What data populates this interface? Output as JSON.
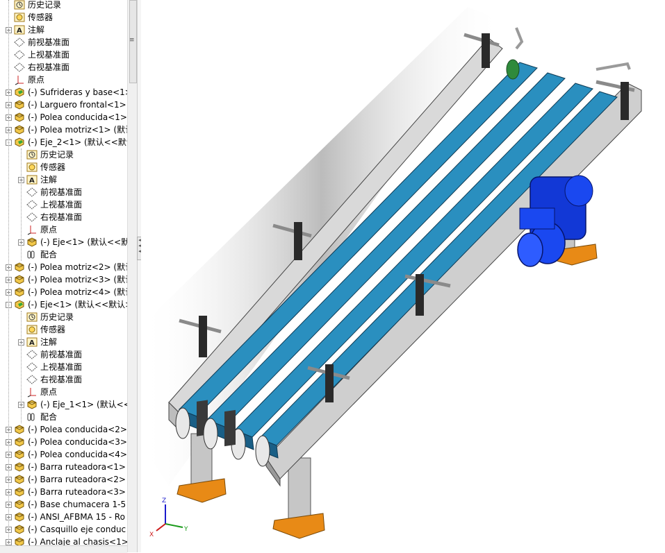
{
  "feature_tree": {
    "rows": [
      {
        "label": "历史记录",
        "icon": "history-icon",
        "indent": 1,
        "expand": ""
      },
      {
        "label": "传感器",
        "icon": "sensor-icon",
        "indent": 1,
        "expand": ""
      },
      {
        "label": "注解",
        "icon": "annotation-icon",
        "indent": 1,
        "expand": "+"
      },
      {
        "label": "前视基准面",
        "icon": "plane-icon",
        "indent": 1,
        "expand": ""
      },
      {
        "label": "上视基准面",
        "icon": "plane-icon",
        "indent": 1,
        "expand": ""
      },
      {
        "label": "右视基准面",
        "icon": "plane-icon",
        "indent": 1,
        "expand": ""
      },
      {
        "label": "原点",
        "icon": "origin-icon",
        "indent": 1,
        "expand": ""
      },
      {
        "label": "(-) Sufrideras y base<1>",
        "icon": "subassembly-icon",
        "indent": 1,
        "expand": "+"
      },
      {
        "label": "(-) Larguero frontal<1>",
        "icon": "part-icon",
        "indent": 1,
        "expand": "+"
      },
      {
        "label": "(-) Polea conducida<1>",
        "icon": "part-icon",
        "indent": 1,
        "expand": "+"
      },
      {
        "label": "(-) Polea motriz<1> (默认",
        "icon": "part-icon",
        "indent": 1,
        "expand": "+"
      },
      {
        "label": "(-) Eje_2<1> (默认<<默认",
        "icon": "subassembly-icon",
        "indent": 1,
        "expand": "-"
      },
      {
        "label": "历史记录",
        "icon": "history-icon",
        "indent": 2,
        "expand": ""
      },
      {
        "label": "传感器",
        "icon": "sensor-icon",
        "indent": 2,
        "expand": ""
      },
      {
        "label": "注解",
        "icon": "annotation-icon",
        "indent": 2,
        "expand": "+"
      },
      {
        "label": "前视基准面",
        "icon": "plane-icon",
        "indent": 2,
        "expand": ""
      },
      {
        "label": "上视基准面",
        "icon": "plane-icon",
        "indent": 2,
        "expand": ""
      },
      {
        "label": "右视基准面",
        "icon": "plane-icon",
        "indent": 2,
        "expand": ""
      },
      {
        "label": "原点",
        "icon": "origin-icon",
        "indent": 2,
        "expand": ""
      },
      {
        "label": "(-) Eje<1> (默认<<默",
        "icon": "part-icon",
        "indent": 2,
        "expand": "+"
      },
      {
        "label": "配合",
        "icon": "mates-icon",
        "indent": 2,
        "expand": ""
      },
      {
        "label": "(-) Polea motriz<2> (默认",
        "icon": "part-icon",
        "indent": 1,
        "expand": "+"
      },
      {
        "label": "(-) Polea motriz<3> (默认",
        "icon": "part-icon",
        "indent": 1,
        "expand": "+"
      },
      {
        "label": "(-) Polea motriz<4> (默认",
        "icon": "part-icon",
        "indent": 1,
        "expand": "+"
      },
      {
        "label": "(-) Eje<1> (默认<<默认>",
        "icon": "subassembly-icon",
        "indent": 1,
        "expand": "-"
      },
      {
        "label": "历史记录",
        "icon": "history-icon",
        "indent": 2,
        "expand": ""
      },
      {
        "label": "传感器",
        "icon": "sensor-icon",
        "indent": 2,
        "expand": ""
      },
      {
        "label": "注解",
        "icon": "annotation-icon",
        "indent": 2,
        "expand": "+"
      },
      {
        "label": "前视基准面",
        "icon": "plane-icon",
        "indent": 2,
        "expand": ""
      },
      {
        "label": "上视基准面",
        "icon": "plane-icon",
        "indent": 2,
        "expand": ""
      },
      {
        "label": "右视基准面",
        "icon": "plane-icon",
        "indent": 2,
        "expand": ""
      },
      {
        "label": "原点",
        "icon": "origin-icon",
        "indent": 2,
        "expand": ""
      },
      {
        "label": "(-) Eje_1<1> (默认<<",
        "icon": "part-icon",
        "indent": 2,
        "expand": "+"
      },
      {
        "label": "配合",
        "icon": "mates-icon",
        "indent": 2,
        "expand": ""
      },
      {
        "label": "(-) Polea conducida<2>",
        "icon": "part-icon",
        "indent": 1,
        "expand": "+"
      },
      {
        "label": "(-) Polea conducida<3>",
        "icon": "part-icon",
        "indent": 1,
        "expand": "+"
      },
      {
        "label": "(-) Polea conducida<4>",
        "icon": "part-icon",
        "indent": 1,
        "expand": "+"
      },
      {
        "label": "(-) Barra ruteadora<1>",
        "icon": "part-icon",
        "indent": 1,
        "expand": "+"
      },
      {
        "label": "(-) Barra ruteadora<2>",
        "icon": "part-icon",
        "indent": 1,
        "expand": "+"
      },
      {
        "label": "(-) Barra ruteadora<3>",
        "icon": "part-icon",
        "indent": 1,
        "expand": "+"
      },
      {
        "label": "(-) Base chumacera 1-5",
        "icon": "part-icon",
        "indent": 1,
        "expand": "+"
      },
      {
        "label": "(-) ANSI_AFBMA 15 - Ro",
        "icon": "part-icon",
        "indent": 1,
        "expand": "+"
      },
      {
        "label": "(-) Casquillo eje conduc",
        "icon": "part-icon",
        "indent": 1,
        "expand": "+"
      },
      {
        "label": "(-) Anclaje al chasis<1>",
        "icon": "part-icon",
        "indent": 1,
        "expand": "+"
      }
    ]
  },
  "triad": {
    "x": "X",
    "y": "Y",
    "z": "Z"
  },
  "colors": {
    "belt": "#2a8fbf",
    "belt_dark": "#1a5f86",
    "frame": "#cfcfcf",
    "frame_dark": "#8a8a8a",
    "motor": "#1238d6",
    "base_plate": "#e88a16",
    "shadow": "#7a7a7a"
  }
}
